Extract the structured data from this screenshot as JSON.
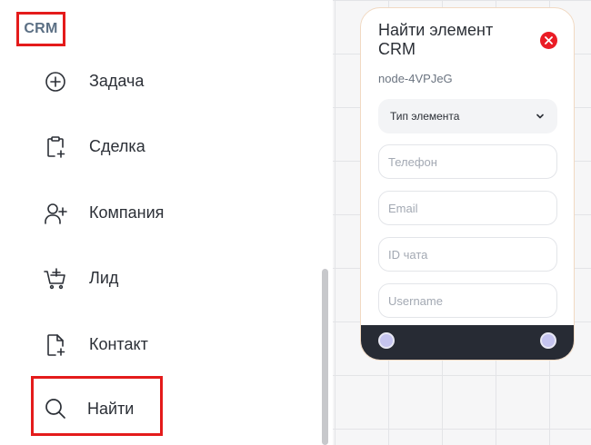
{
  "sidebar": {
    "section_title": "CRM",
    "items": [
      {
        "label": "Задача",
        "icon": "plus-circle-icon"
      },
      {
        "label": "Сделка",
        "icon": "clipboard-plus-icon"
      },
      {
        "label": "Компания",
        "icon": "user-plus-icon"
      },
      {
        "label": "Лид",
        "icon": "cart-plus-icon"
      },
      {
        "label": "Контакт",
        "icon": "file-plus-icon"
      },
      {
        "label": "Найти",
        "icon": "search-icon"
      }
    ]
  },
  "node": {
    "title": "Найти элемент CRM",
    "id": "node-4VPJeG",
    "select": {
      "value": "Тип элемента"
    },
    "fields": {
      "phone_placeholder": "Телефон",
      "email_placeholder": "Email",
      "chat_id_placeholder": "ID чата",
      "username_placeholder": "Username"
    }
  },
  "colors": {
    "highlight_border": "#e41b1b",
    "close_button": "#ea1c25",
    "node_footer": "#272b34",
    "handle": "#c5c4ef",
    "crm_title": "#5b6f84"
  }
}
